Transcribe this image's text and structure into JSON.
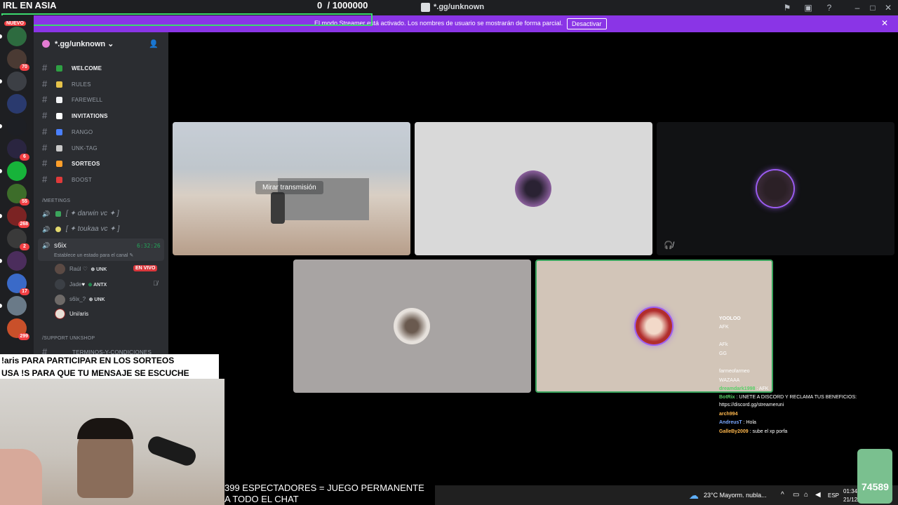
{
  "overlay": {
    "title": "IRL EN ASIA",
    "goal_current": "0",
    "goal_target": "/ 1000000",
    "ticker_1": "!aris PARA PARTICIPAR EN LOS SORTEOS",
    "ticker_2": "USA !S PARA QUE TU MENSAJE SE ESCUCHE",
    "spectators_1": "399 ESPECTADORES = JUEGO PERMANENTE",
    "spectators_2": "A TODO EL CHAT",
    "counter": "74589"
  },
  "window": {
    "title": "*.gg/unknown",
    "icon": "app-icon"
  },
  "banner": {
    "text": "El modo Streamer está activado. Los nombres de usuario se mostrarán de forma parcial.",
    "button": "Desactivar",
    "close": "✕",
    "bg_color": "#8a35e6"
  },
  "rail": {
    "new_badge": "NUEVO",
    "servers": [
      {
        "badge": ""
      },
      {
        "badge": "70"
      },
      {
        "badge": ""
      },
      {
        "badge": ""
      },
      {
        "badge": ""
      },
      {
        "badge": "6"
      },
      {
        "badge": ""
      },
      {
        "badge": "55"
      },
      {
        "badge": "268"
      },
      {
        "badge": "2"
      },
      {
        "badge": ""
      },
      {
        "badge": "17"
      },
      {
        "badge": ""
      },
      {
        "badge": "299"
      }
    ]
  },
  "sidebar": {
    "server_name": "*.gg/unknown",
    "channels": [
      {
        "name": "WELCOME",
        "bright": true
      },
      {
        "name": "RULES",
        "bright": false
      },
      {
        "name": "FAREWELL",
        "bright": false
      },
      {
        "name": "INVITATIONS",
        "bright": true
      },
      {
        "name": "RANGO",
        "bright": false
      },
      {
        "name": "UNK-TAG",
        "bright": false
      },
      {
        "name": "SORTEOS",
        "bright": true
      },
      {
        "name": "BOOST",
        "bright": false
      }
    ],
    "category_meetings": "/MEETINGS",
    "voice_channels": [
      {
        "name": "[ ✦ darwin vc ✦ ]"
      },
      {
        "name": "[ ✦ toukaa vc ✦ ]"
      }
    ],
    "active_vc": {
      "name": "s6ix",
      "timer": "6:32:26",
      "status": "Establece un estado para el canal"
    },
    "members": [
      {
        "name": "Raúl",
        "tag": "UNK"
      },
      {
        "name": "Jade",
        "tag": "ANTX"
      },
      {
        "name": "s6ix_?",
        "tag": "UNK"
      },
      {
        "name": "Uni/aris",
        "tag": ""
      }
    ],
    "live_badge": "EN VIVO",
    "category_support": "/SUPPORT UNKSHOP",
    "partial_channel": "TERMINOS-Y-CONDICIONES"
  },
  "stage": {
    "watch_button": "Mirar transmisión"
  },
  "chat": [
    {
      "user": "YOOLOO",
      "msg": "",
      "color": "#ffffff"
    },
    {
      "user": "",
      "msg": "AFK",
      "color": "#ffffff"
    },
    {
      "user": "",
      "msg": "AFk",
      "color": "#ff6b6b"
    },
    {
      "user": "",
      "msg": "GG",
      "color": "#cfcfcf"
    },
    {
      "user": "",
      "msg": "farmeofarmeo",
      "color": "#ffb84d"
    },
    {
      "user": "",
      "msg": "WAZAAA",
      "color": "#cfcfcf"
    },
    {
      "user": "dreamdark1998",
      "msg": "AFK",
      "color": "#58d068"
    },
    {
      "user": "BotRix",
      "msg": "UNETE A DISCORD Y RECLAMA TUS BENEFICIOS:",
      "color": "#58d068"
    },
    {
      "user": "",
      "msg": "https://discord.gg/streameruni",
      "color": "#ffffff"
    },
    {
      "user": "arch994",
      "msg": "",
      "color": "#ffb84d"
    },
    {
      "user": "AndreusT",
      "msg": "Hola",
      "color": "#7aa8ff"
    },
    {
      "user": "GalleBy2009",
      "msg": "sube el xp porfa",
      "color": "#ffb84d"
    }
  ],
  "taskbar": {
    "weather": "23°C  Mayorm. nubla...",
    "lang": "ESP",
    "time": "01:34",
    "date": "21/12/"
  }
}
